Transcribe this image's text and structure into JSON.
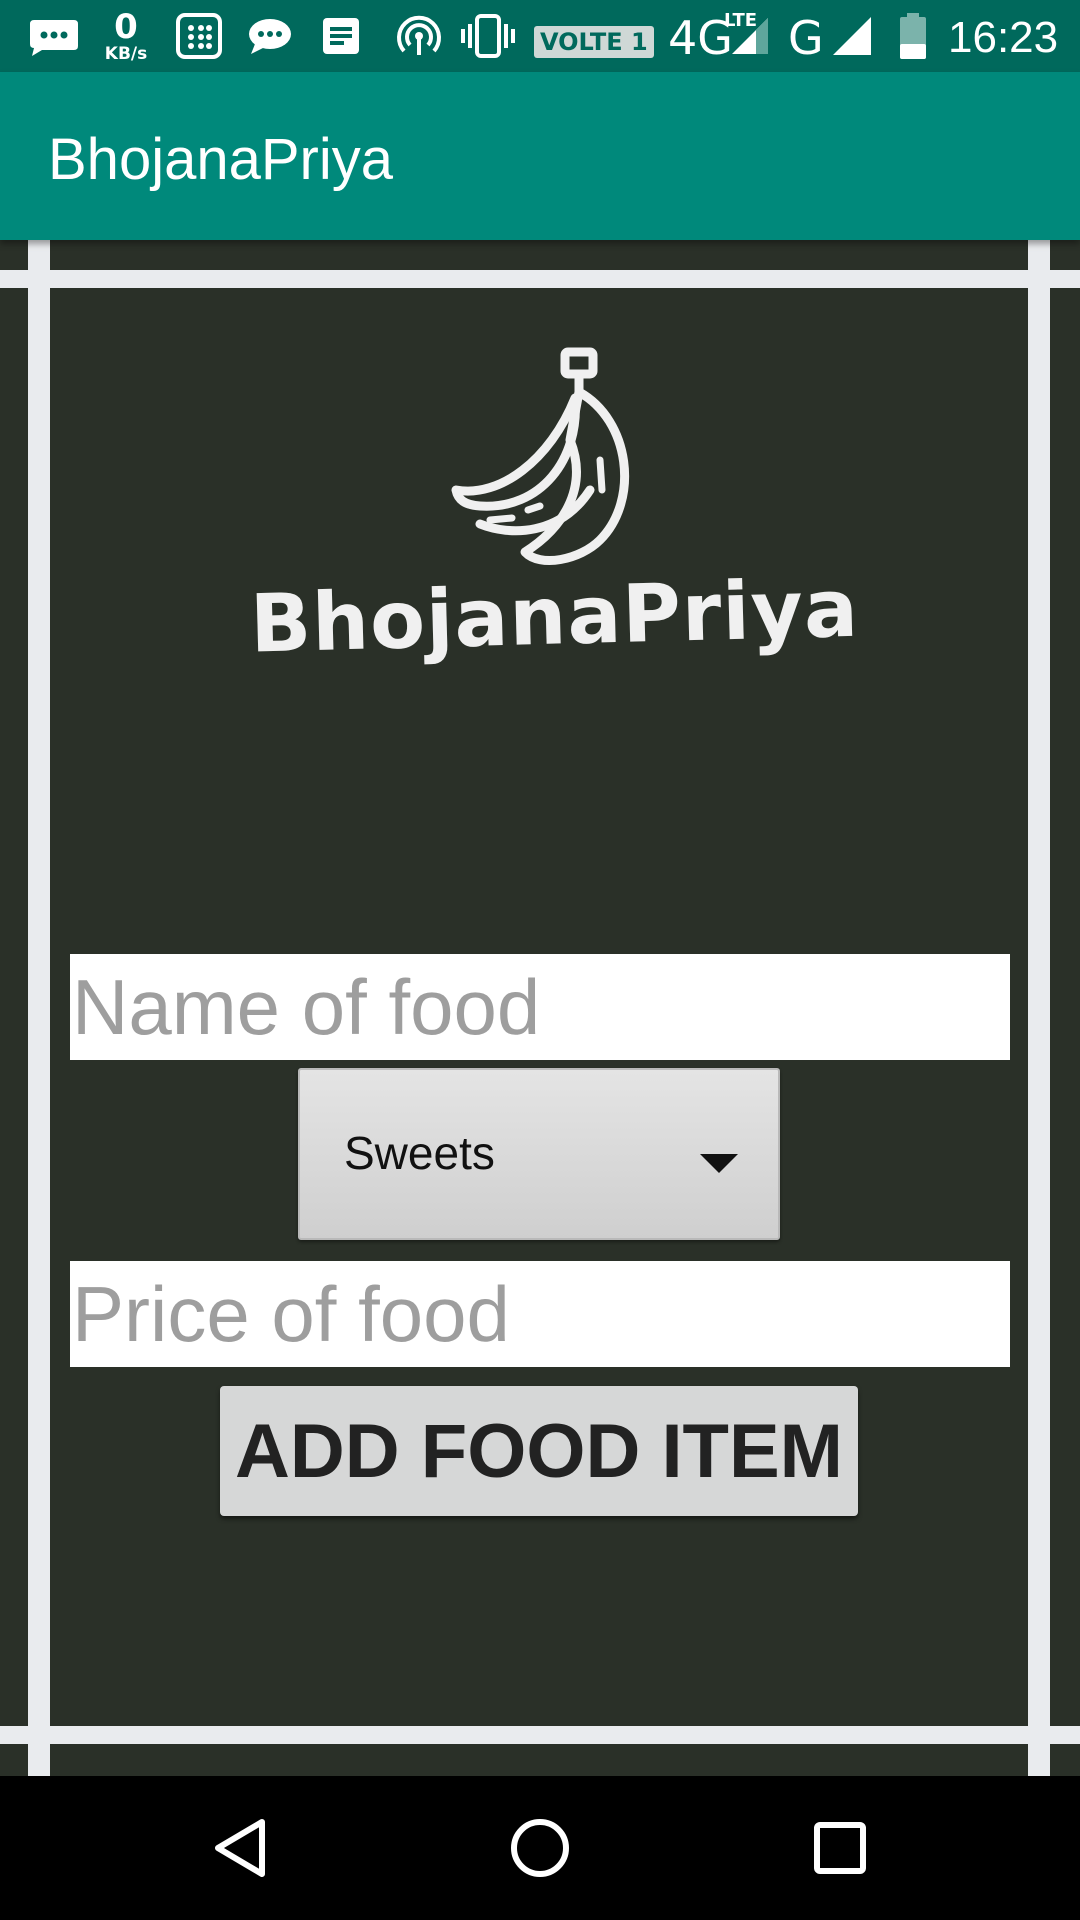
{
  "status_bar": {
    "speed_value": "0",
    "speed_unit": "KB/s",
    "volte_label": "VOLTE 1",
    "network_primary": "4G",
    "network_primary_sub": "LTE",
    "network_secondary": "G",
    "time": "16:23",
    "icons": [
      "chat-bubble-icon",
      "grid-icon",
      "message-icon",
      "notes-icon",
      "hotspot-icon",
      "vibrate-icon",
      "signal-icon",
      "battery-icon"
    ]
  },
  "app_bar": {
    "title": "BhojanaPriya"
  },
  "logo": {
    "text": "BhojanaPriya",
    "icon": "banana-icon"
  },
  "form": {
    "name_placeholder": "Name of food",
    "name_value": "",
    "category_selected": "Sweets",
    "price_placeholder": "Price of food",
    "price_value": "",
    "add_button_label": "ADD FOOD ITEM"
  },
  "colors": {
    "status_bar": "#00695C",
    "app_bar": "#00897B",
    "background": "#2a3028",
    "frame": "#e9ebee"
  },
  "nav_bar": {
    "icons": [
      "back-icon",
      "home-icon",
      "recents-icon"
    ]
  }
}
